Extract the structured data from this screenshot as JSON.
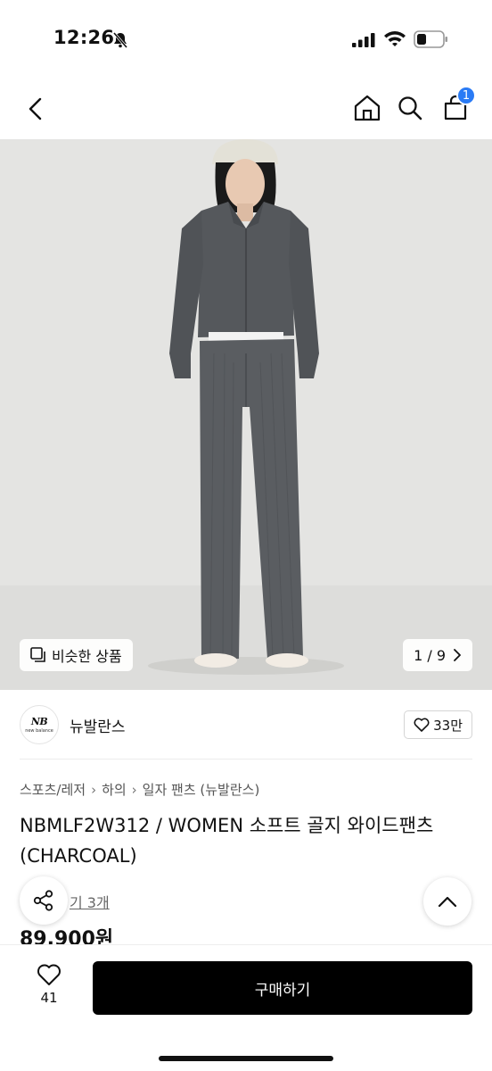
{
  "status_bar": {
    "time": "12:26"
  },
  "nav": {
    "cart_count": "1"
  },
  "gallery": {
    "similar_label": "비슷한 상품",
    "page_indicator": "1 / 9"
  },
  "brand": {
    "logo_mark": "NB",
    "logo_text": "new balance",
    "name": "뉴발란스",
    "likes": "33만"
  },
  "breadcrumb": {
    "items": [
      "스포츠/레저",
      "하의",
      "일자 팬츠 (뉴발란스)"
    ]
  },
  "product": {
    "title": "NBMLF2W312 / WOMEN 소프트 골지 와이드팬츠 (CHARCOAL)",
    "review_link": "기 3개",
    "price": "89,900원"
  },
  "bottom_bar": {
    "wish_count": "41",
    "buy_label": "구매하기"
  },
  "colors": {
    "accent_badge": "#2a7bf5",
    "buy_button": "#000000",
    "image_background": "#e4e4e2",
    "garment": "#55585c"
  },
  "icons": [
    "bell-slash-icon",
    "signal-icon",
    "wifi-icon",
    "battery-icon",
    "back-icon",
    "home-icon",
    "search-icon",
    "cart-icon",
    "similar-icon",
    "chevron-right-icon",
    "heart-icon",
    "share-icon",
    "chevron-up-icon"
  ]
}
